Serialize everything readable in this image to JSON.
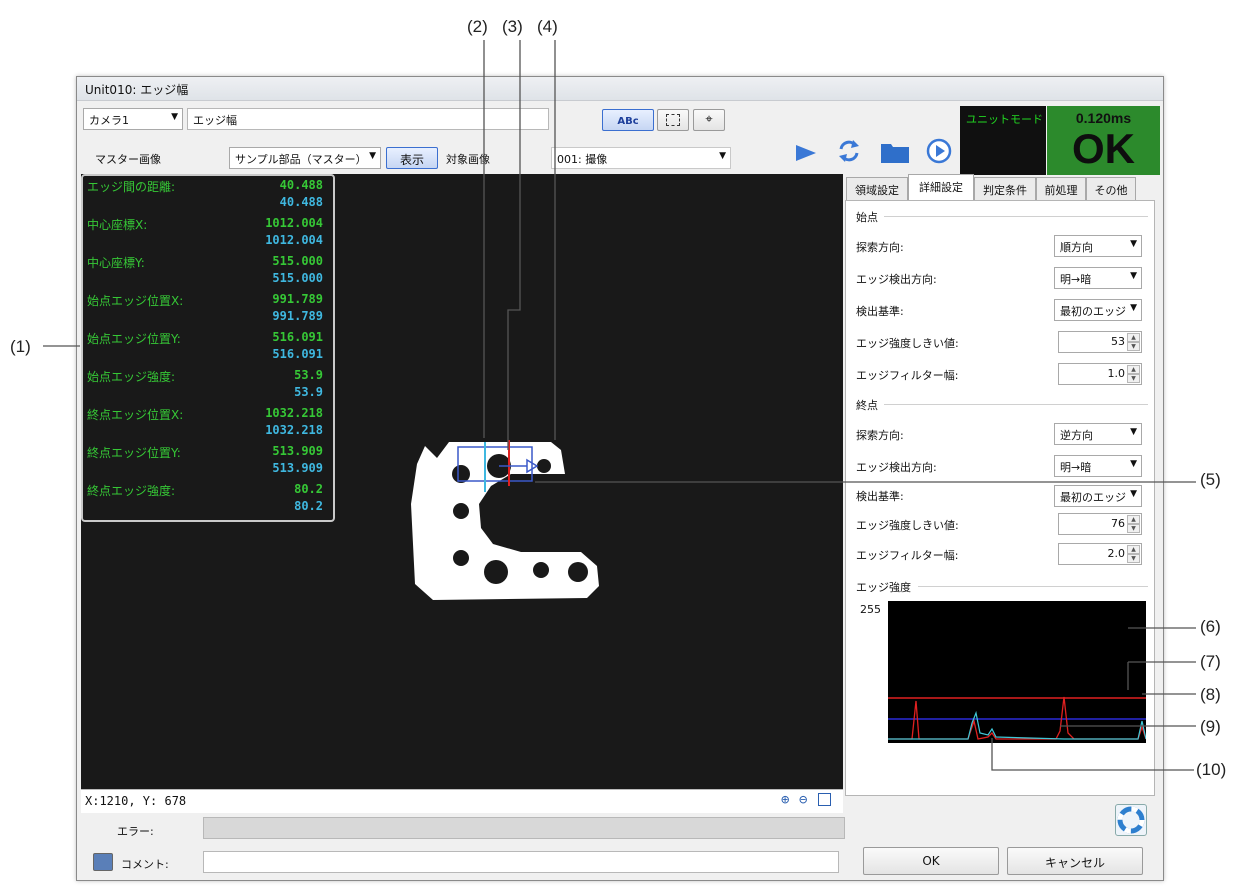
{
  "callouts": [
    "(1)",
    "(2)",
    "(3)",
    "(4)",
    "(5)",
    "(6)",
    "(7)",
    "(8)",
    "(9)",
    "(10)"
  ],
  "window": {
    "title": "Unit010: エッジ幅"
  },
  "toolbar": {
    "camera": "カメラ1",
    "unit_name": "エッジ幅",
    "master_label": "マスター画像",
    "master_value": "サンプル部品（マスター）",
    "show_button": "表示",
    "target_label": "対象画像",
    "target_value": "001: 撮像",
    "text_toggle": "ABc"
  },
  "status_box": {
    "mode": "ユニットモード",
    "time": "0.120ms",
    "result": "OK"
  },
  "measurements": [
    {
      "name": "エッジ間の距離:",
      "v1": "40.488",
      "v2": "40.488"
    },
    {
      "name": "中心座標X:",
      "v1": "1012.004",
      "v2": "1012.004"
    },
    {
      "name": "中心座標Y:",
      "v1": "515.000",
      "v2": "515.000"
    },
    {
      "name": "始点エッジ位置X:",
      "v1": "991.789",
      "v2": "991.789"
    },
    {
      "name": "始点エッジ位置Y:",
      "v1": "516.091",
      "v2": "516.091"
    },
    {
      "name": "始点エッジ強度:",
      "v1": "53.9",
      "v2": "53.9"
    },
    {
      "name": "終点エッジ位置X:",
      "v1": "1032.218",
      "v2": "1032.218"
    },
    {
      "name": "終点エッジ位置Y:",
      "v1": "513.909",
      "v2": "513.909"
    },
    {
      "name": "終点エッジ強度:",
      "v1": "80.2",
      "v2": "80.2"
    }
  ],
  "coords": "X:1210, Y: 678",
  "tabs": [
    "領域設定",
    "詳細設定",
    "判定条件",
    "前処理",
    "その他"
  ],
  "start_group": {
    "title": "始点",
    "rows": [
      {
        "label": "探索方向:",
        "value": "順方向"
      },
      {
        "label": "エッジ検出方向:",
        "value": "明→暗"
      },
      {
        "label": "検出基準:",
        "value": "最初のエッジ"
      },
      {
        "label": "エッジ強度しきい値:",
        "value": "53"
      },
      {
        "label": "エッジフィルター幅:",
        "value": "1.0"
      }
    ]
  },
  "end_group": {
    "title": "終点",
    "rows": [
      {
        "label": "探索方向:",
        "value": "逆方向"
      },
      {
        "label": "エッジ検出方向:",
        "value": "明→暗"
      },
      {
        "label": "検出基準:",
        "value": "最初のエッジ"
      },
      {
        "label": "エッジ強度しきい値:",
        "value": "76"
      },
      {
        "label": "エッジフィルター幅:",
        "value": "2.0"
      }
    ]
  },
  "strength": {
    "title": "エッジ強度",
    "max_label": "255"
  },
  "bottom": {
    "error_label": "エラー:",
    "comment_label": "コメント:",
    "ok_button": "OK",
    "cancel_button": "キャンセル"
  },
  "colors": {
    "ok_green": "#2c8a2c",
    "value_green": "#36c836",
    "value_cyan": "#3fb8e0",
    "threshold_red": "#e02020",
    "threshold_blue": "#2a2ad8"
  }
}
